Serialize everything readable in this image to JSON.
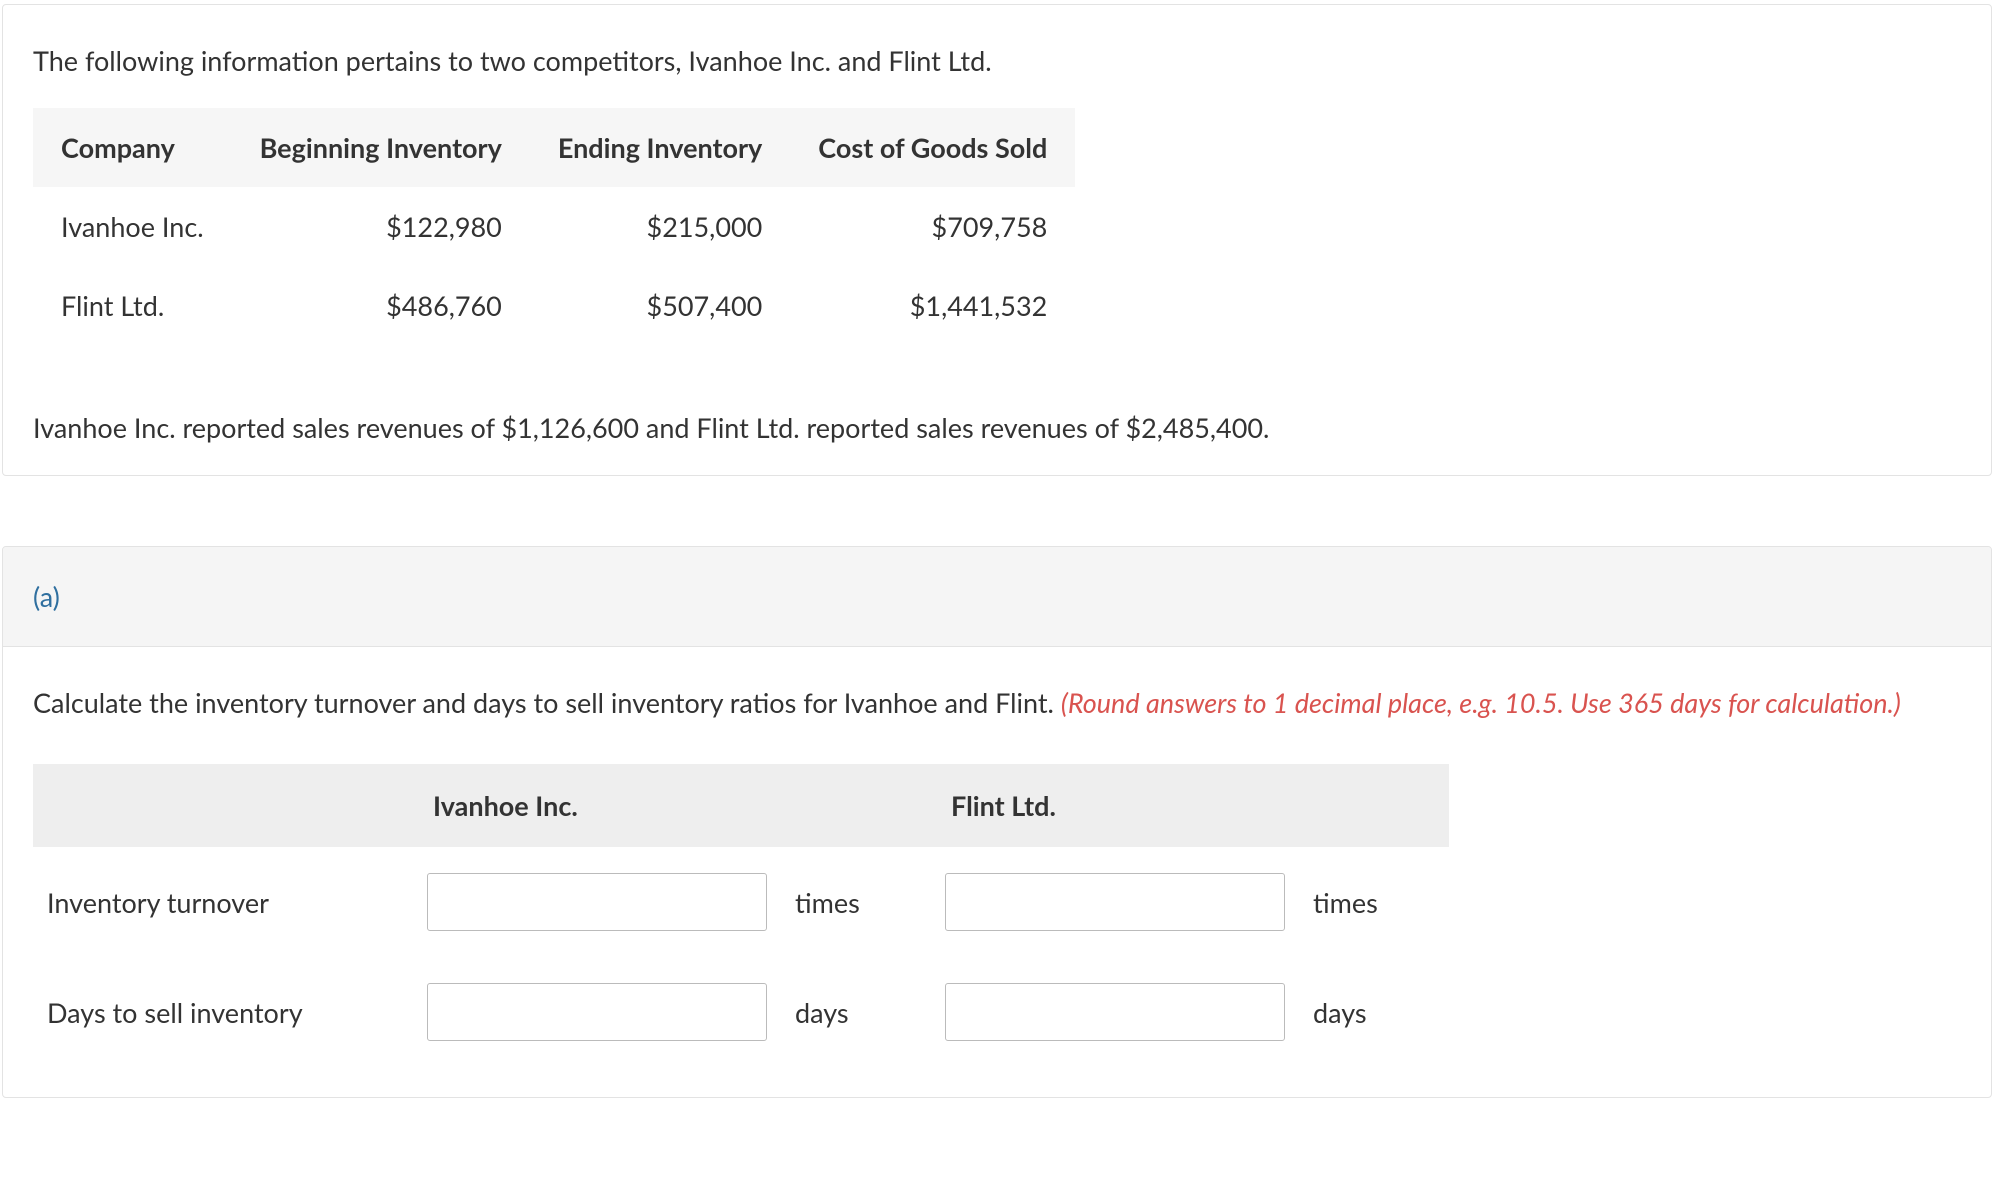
{
  "intro": "The following information pertains to two competitors, Ivanhoe Inc. and Flint Ltd.",
  "info_table": {
    "headers": {
      "company": "Company",
      "beginning": "Beginning Inventory",
      "ending": "Ending Inventory",
      "cogs": "Cost of Goods Sold"
    },
    "rows": [
      {
        "company": "Ivanhoe Inc.",
        "beginning": "$122,980",
        "ending": "$215,000",
        "cogs": "$709,758"
      },
      {
        "company": "Flint Ltd.",
        "beginning": "$486,760",
        "ending": "$507,400",
        "cogs": "$1,441,532"
      }
    ]
  },
  "revenues_text": "Ivanhoe Inc. reported sales revenues of $1,126,600 and Flint Ltd. reported sales revenues of $2,485,400.",
  "part_label": "(a)",
  "calc": {
    "base": "Calculate the inventory turnover and days to sell inventory ratios for Ivanhoe and Flint. ",
    "red": "(Round answers to 1 decimal place, e.g. 10.5. Use 365 days for calculation.)"
  },
  "answers": {
    "col_ivanhoe": "Ivanhoe Inc.",
    "col_flint": "Flint Ltd.",
    "rows": [
      {
        "label": "Inventory turnover",
        "unit": "times"
      },
      {
        "label": "Days to sell inventory",
        "unit": "days"
      }
    ]
  }
}
